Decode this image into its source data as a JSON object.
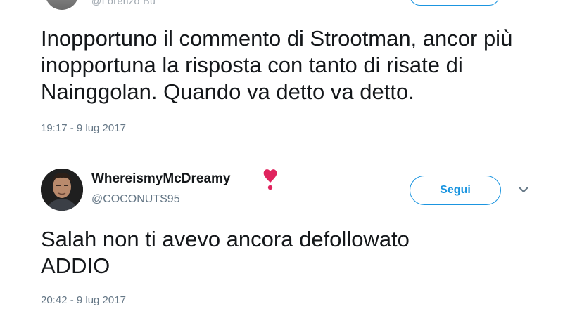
{
  "tweet_top": {
    "handle": "@Lorenzo Bu",
    "text": "Inopportuno il commento di Strootman, ancor più inopportuna la risposta con tanto di risate di Nainggolan. Quando va detto va detto.",
    "timestamp": "19:17 - 9 lug 2017"
  },
  "tweet_reply": {
    "display_name": "WhereismyMcDreamy",
    "name_emoji_icon": "heavy-heart-exclamation-icon",
    "handle": "@COCONUTS95",
    "follow_label": "Segui",
    "menu_icon": "chevron-down-icon",
    "text_lines": [
      "Salah non ti avevo ancora defollowato",
      "ADDIO"
    ],
    "timestamp": "20:42 - 9 lug 2017"
  },
  "colors": {
    "accent": "#1b95e0",
    "text": "#14171a",
    "secondary": "#657786",
    "heart": "#e0245e",
    "divider": "#e6ecf0"
  }
}
